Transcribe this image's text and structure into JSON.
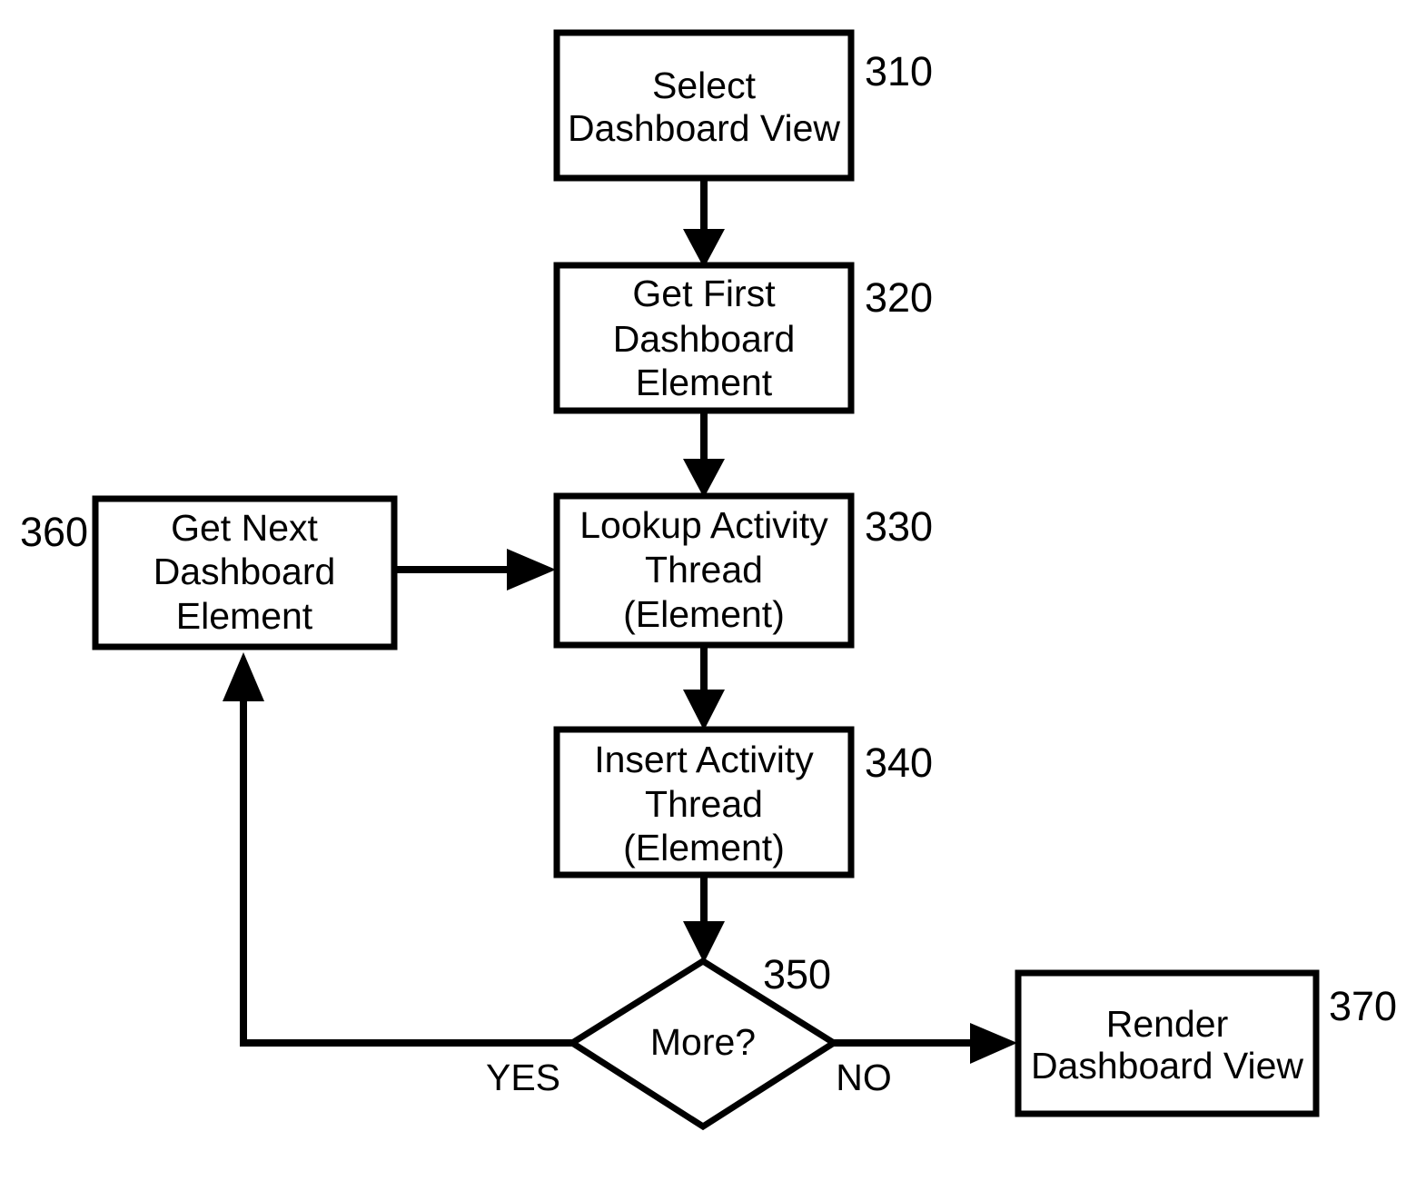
{
  "diagram": {
    "type": "flowchart",
    "title": "",
    "nodes": [
      {
        "id": "n310",
        "ref": "310",
        "shape": "process",
        "lines": [
          "Select",
          "Dashboard View"
        ]
      },
      {
        "id": "n320",
        "ref": "320",
        "shape": "process",
        "lines": [
          "Get First",
          "Dashboard",
          "Element"
        ]
      },
      {
        "id": "n330",
        "ref": "330",
        "shape": "process",
        "lines": [
          "Lookup Activity",
          "Thread",
          "(Element)"
        ]
      },
      {
        "id": "n340",
        "ref": "340",
        "shape": "process",
        "lines": [
          "Insert Activity",
          "Thread",
          "(Element)"
        ]
      },
      {
        "id": "n350",
        "ref": "350",
        "shape": "decision",
        "lines": [
          "More?"
        ]
      },
      {
        "id": "n360",
        "ref": "360",
        "shape": "process",
        "lines": [
          "Get Next",
          "Dashboard",
          "Element"
        ]
      },
      {
        "id": "n370",
        "ref": "370",
        "shape": "process",
        "lines": [
          "Render",
          "Dashboard View"
        ]
      }
    ],
    "edges": [
      {
        "from": "n310",
        "to": "n320",
        "label": ""
      },
      {
        "from": "n320",
        "to": "n330",
        "label": ""
      },
      {
        "from": "n330",
        "to": "n340",
        "label": ""
      },
      {
        "from": "n340",
        "to": "n350",
        "label": ""
      },
      {
        "from": "n350",
        "to": "n360",
        "label": "YES"
      },
      {
        "from": "n350",
        "to": "n370",
        "label": "NO"
      },
      {
        "from": "n360",
        "to": "n330",
        "label": ""
      }
    ],
    "branch_labels": {
      "yes": "YES",
      "no": "NO"
    },
    "colors": {
      "stroke": "#000000",
      "fill": "#ffffff",
      "text": "#000000"
    }
  }
}
